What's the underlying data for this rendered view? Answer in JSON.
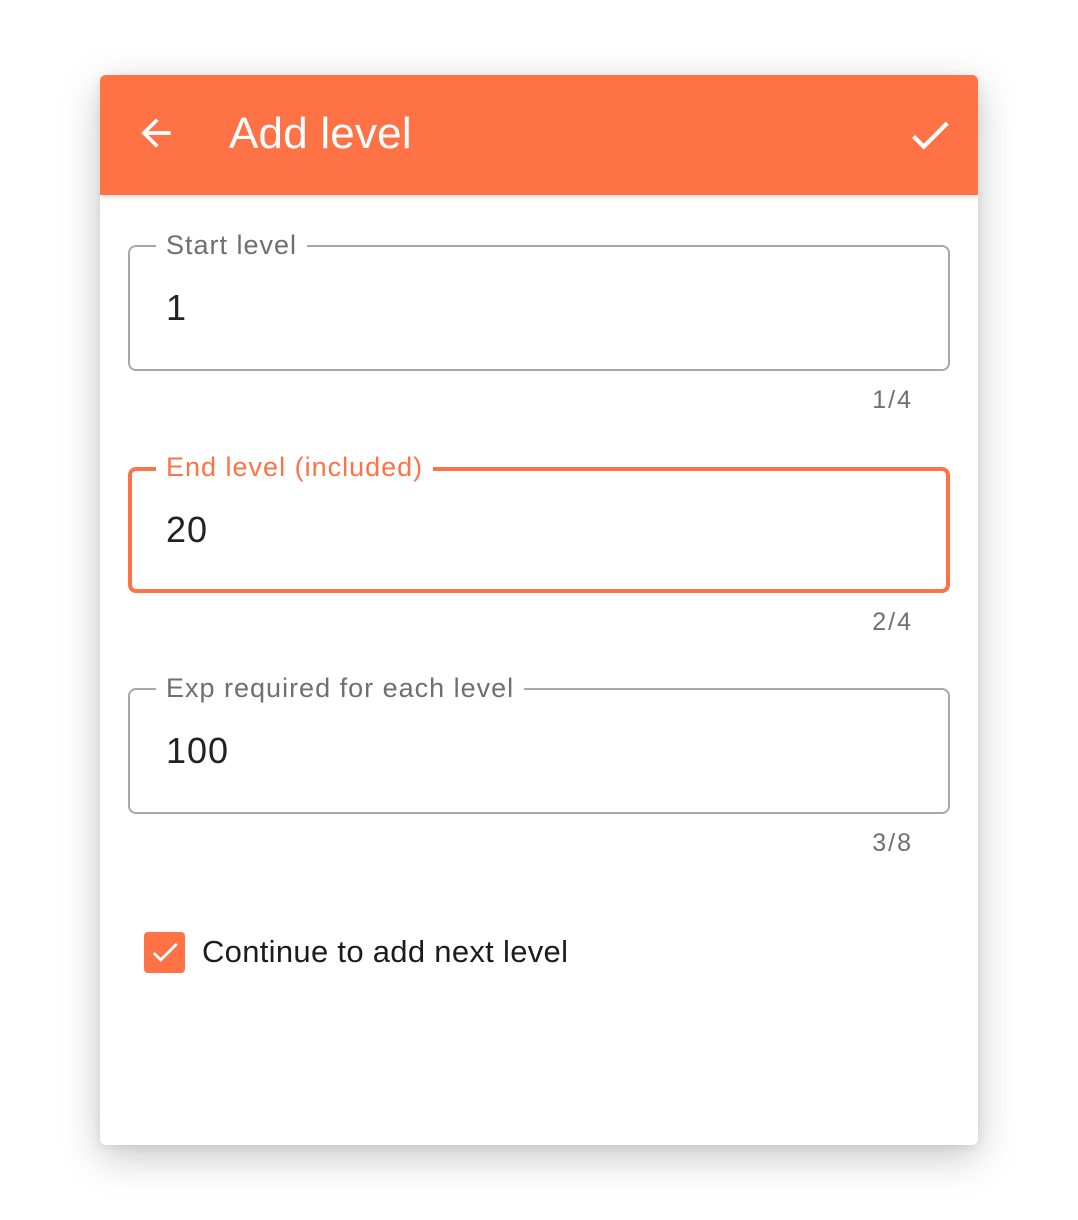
{
  "header": {
    "title": "Add level",
    "back_icon": "arrow-left-icon",
    "confirm_icon": "check-icon"
  },
  "fields": [
    {
      "label": "Start level",
      "value": "1",
      "counter": "1/4",
      "focused": false
    },
    {
      "label": "End level (included)",
      "value": "20",
      "counter": "2/4",
      "focused": true
    },
    {
      "label": "Exp required for each level",
      "value": "100",
      "counter": "3/8",
      "focused": false
    }
  ],
  "continue_option": {
    "label": "Continue to add next level",
    "checked": true
  },
  "colors": {
    "accent": "#ff7245",
    "outline": "#a8a8a8",
    "label": "#6f6f6f"
  }
}
